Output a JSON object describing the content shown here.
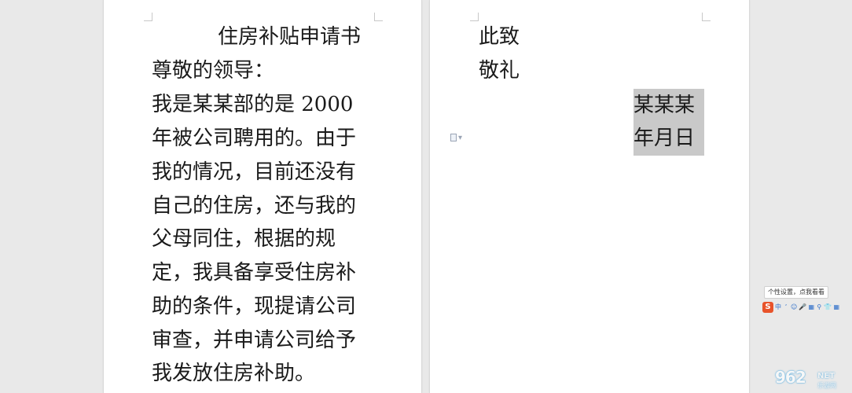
{
  "document": {
    "page1": {
      "title": "住房补贴申请书",
      "lines": [
        "尊敬的领导：",
        "我是某某部的是 2000",
        "年被公司聘用的。由于",
        "我的情况，目前还没有",
        "自己的住房，还与我的",
        "父母同住，根据的规",
        "定，我具备享受住房补",
        "助的条件，现提请公司",
        "审查，并申请公司给予",
        "我发放住房补助。"
      ]
    },
    "page2": {
      "lines": [
        "此致",
        "敬礼"
      ],
      "signature": "某某某",
      "date": "年月日"
    }
  },
  "ime": {
    "tooltip": "个性设置，点我看看",
    "logo": "S",
    "mode": "中",
    "items": [
      "ʼ",
      "☺",
      "🎤",
      "▦",
      "⚲",
      "👕",
      "▦"
    ]
  },
  "watermark": {
    "main": "962",
    "sub": "NET",
    "cn": "乐游网"
  },
  "colors": {
    "background": "#e9e9e9",
    "page": "#ffffff",
    "selection": "#c9c9c9",
    "ime_accent": "#e8532a"
  }
}
